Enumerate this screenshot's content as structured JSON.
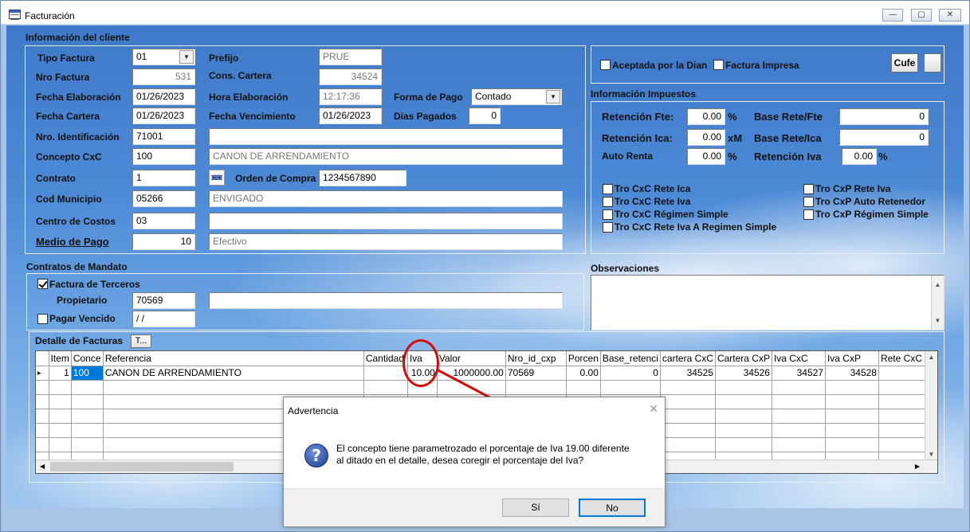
{
  "window": {
    "title": "Facturación",
    "min": "—",
    "max": "▢",
    "close": "✕"
  },
  "cliente": {
    "section": "Información del cliente",
    "tipo_factura": {
      "label": "Tipo Factura",
      "value": "01"
    },
    "prefijo": {
      "label": "Prefijo",
      "value": "PRUE"
    },
    "nro_factura": {
      "label": "Nro Factura",
      "value": "531"
    },
    "cons_cartera": {
      "label": "Cons. Cartera",
      "value": "34524"
    },
    "fecha_elab": {
      "label": "Fecha Elaboración",
      "value": "01/26/2023"
    },
    "hora_elab": {
      "label": "Hora Elaboración",
      "value": "12:17:36"
    },
    "forma_pago": {
      "label": "Forma de Pago",
      "value": "Contado"
    },
    "fecha_cartera": {
      "label": "Fecha Cartera",
      "value": "01/26/2023"
    },
    "fecha_venc": {
      "label": "Fecha Vencimiento",
      "value": "01/26/2023"
    },
    "dias_pagados": {
      "label": "Dias Pagados",
      "value": "0"
    },
    "nro_ident": {
      "label": "Nro. Identificación",
      "value": "71001"
    },
    "concepto": {
      "label": "Concepto  CxC",
      "value": "100",
      "desc": "CANON DE ARRENDAMIENTO"
    },
    "contrato": {
      "label": "Contrato",
      "value": "1"
    },
    "orden_compra": {
      "label": "Orden de Compra",
      "value": "1234567890"
    },
    "cod_municipio": {
      "label": "Cod Municipio",
      "value": "05266",
      "desc": "ENVIGADO"
    },
    "centro_costos": {
      "label": "Centro de Costos",
      "value": "03"
    },
    "medio_pago": {
      "label": "Medio de Pago",
      "value": "10",
      "desc": "Efectivo"
    }
  },
  "right": {
    "aceptada": "Aceptada por la Dian",
    "impresa": "Factura Impresa",
    "cufe": "Cufe",
    "impuestos_title": "Información Impuestos",
    "ret_fte": {
      "label": "Retención Fte:",
      "value": "0.00",
      "unit": "%"
    },
    "base_fte": {
      "label": "Base Rete/Fte",
      "value": "0"
    },
    "ret_ica": {
      "label": "Retención Ica:",
      "value": "0.00",
      "unit": "xM"
    },
    "base_ica": {
      "label": "Base Rete/Ica",
      "value": "0"
    },
    "auto_renta": {
      "label": "Auto Renta",
      "value": "0.00",
      "unit": "%"
    },
    "ret_iva": {
      "label": "Retención Iva",
      "value": "0.00",
      "unit": "%"
    },
    "checks_left": [
      "Tro CxC Rete Ica",
      "Tro CxC Rete Iva",
      "Tro CxC Régimen Simple",
      "Tro CxC Rete Iva A Regimen Simple"
    ],
    "checks_right": [
      "Tro CxP Rete Iva",
      "Tro CxP Auto Retenedor",
      "Tro CxP Régimen Simple"
    ],
    "observaciones": "Observaciones"
  },
  "mandato": {
    "section": "Contratos de Mandato",
    "terceros": "Factura de Terceros",
    "propietario": {
      "label": "Propietario",
      "value": "70569"
    },
    "pagar_vencido": {
      "label": "Pagar Vencido",
      "value": " / /"
    }
  },
  "detalle": {
    "title": "Detalle de Facturas",
    "tbutton": "T...",
    "columns": [
      "",
      "Item",
      "Conce",
      "Referencia",
      "Cantidad",
      "Iva",
      "Valor",
      "Nro_id_cxp",
      "Porcen",
      "Base_retenci",
      "cartera CxC",
      "Cartera CxP",
      "Iva CxC",
      "Iva CxP",
      "Rete CxC"
    ],
    "row": [
      "▸",
      "1",
      "100",
      "CANON DE ARRENDAMIENTO",
      "",
      "10.00",
      "1000000.00",
      "70569",
      "0.00",
      "0",
      "34525",
      "34526",
      "34527",
      "34528",
      ""
    ]
  },
  "dialog": {
    "title": "Advertencia",
    "message": "El concepto tiene parametrozado el porcentaje de Iva 19.00 diferente al ditado en el detalle, desea coregir el porcentaje del Iva?",
    "yes": "Sí",
    "no": "No",
    "close": "✕"
  },
  "colors": {
    "annotation": "#d40b0b",
    "sky": "#4d8ad6"
  }
}
